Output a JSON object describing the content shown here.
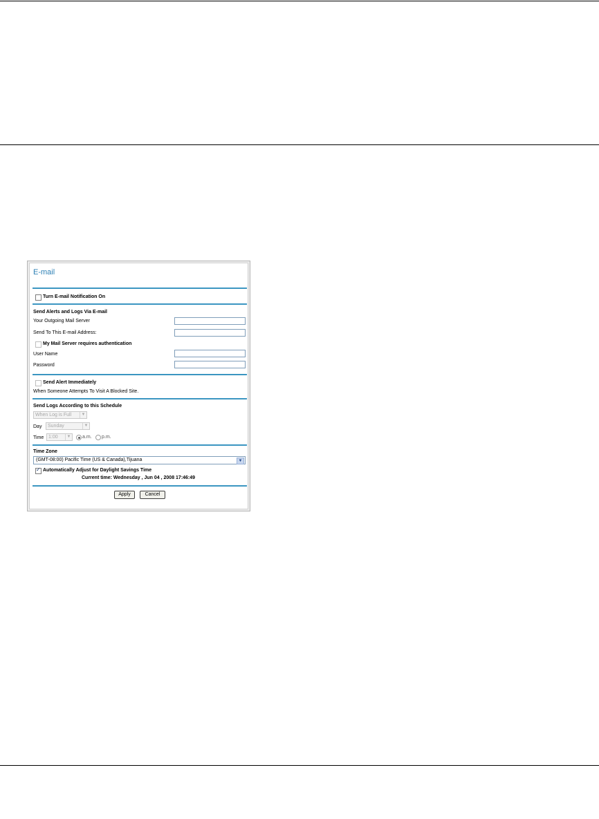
{
  "dialog": {
    "title": "E-mail",
    "email_notification": {
      "label": "Turn E-mail Notification On",
      "checked": false
    },
    "send_alerts": {
      "heading": "Send Alerts and Logs Via E-mail",
      "outgoing_server_label": "Your Outgoing Mail Server",
      "outgoing_server_value": "",
      "send_to_label": "Send To This E-mail Address:",
      "send_to_value": "",
      "auth_label": "My Mail Server requires authentication",
      "auth_checked": false,
      "username_label": "User Name",
      "username_value": "",
      "password_label": "Password",
      "password_value": ""
    },
    "alert": {
      "label": "Send Alert Immediately",
      "checked": false,
      "description": "When Someone Attempts To Visit A Blocked Site."
    },
    "schedule": {
      "heading": "Send Logs According to this Schedule",
      "frequency_selected": "When Log is Full",
      "day_label": "Day",
      "day_selected": "Sunday",
      "time_label": "Time",
      "time_selected": "1:00",
      "am_label": "a.m.",
      "pm_label": "p.m.",
      "selected_period": "a.m."
    },
    "timezone": {
      "heading": "Time Zone",
      "selected": "(GMT-08:00) Pacific Time (US & Canada),Tijuana",
      "dst_label": "Automatically Adjust for Daylight Savings Time",
      "dst_checked": true,
      "current_time": "Current time: Wednesday , Jun 04 , 2008 17:46:49"
    },
    "buttons": {
      "apply": "Apply",
      "cancel": "Cancel"
    }
  },
  "icons": {
    "dropdown": "chevron-down-icon",
    "check": "checkmark-icon"
  }
}
